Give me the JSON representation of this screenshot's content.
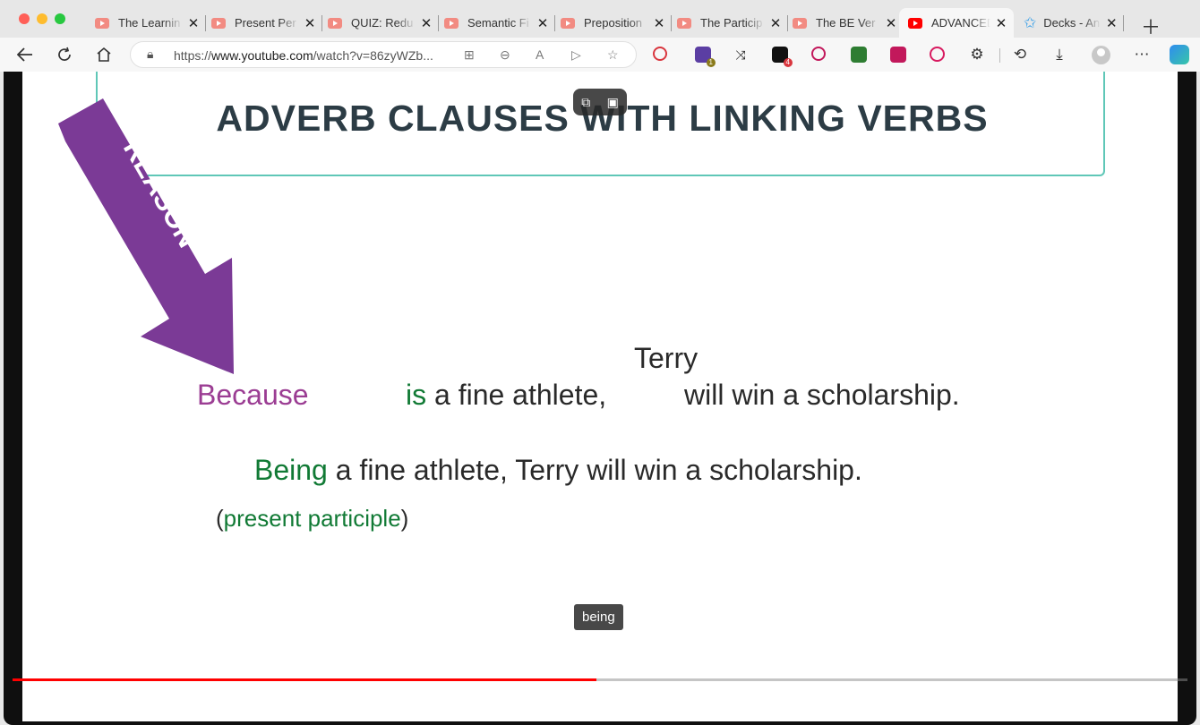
{
  "tabs": [
    {
      "title": "The Learnin",
      "active": false
    },
    {
      "title": "Present Per",
      "active": false
    },
    {
      "title": "QUIZ: Redu",
      "active": false
    },
    {
      "title": "Semantic Fi",
      "active": false
    },
    {
      "title": "Preposition",
      "active": false
    },
    {
      "title": "The Particip",
      "active": false
    },
    {
      "title": "The BE Ver",
      "active": false
    },
    {
      "title": "ADVANCED",
      "active": true
    },
    {
      "title": "Decks - An",
      "active": false
    }
  ],
  "address": {
    "prefix": "https://",
    "domain": "www.youtube.com",
    "path": "/watch?v=86zyWZb..."
  },
  "extensions": [
    {
      "name": "magnifier-extension-icon",
      "color": "#d9363e"
    },
    {
      "name": "pen-extension-icon",
      "color": "#5b3ea3",
      "badge": "1",
      "badge_color": "#8a7a1a"
    },
    {
      "name": "shuffle-extension-icon",
      "color": "#222222"
    },
    {
      "name": "camera-extension-icon",
      "color": "#111111",
      "badge": "4",
      "badge_color": "#d9363e"
    },
    {
      "name": "screen-record-extension-icon",
      "color": "#c2185b"
    },
    {
      "name": "download-green-extension-icon",
      "color": "#2e7d32"
    },
    {
      "name": "trello-extension-icon",
      "color": "#c2185b"
    },
    {
      "name": "play-extension-icon",
      "color": "#d81b60"
    }
  ],
  "slide": {
    "title": "ADVERB CLAUSES WITH LINKING VERBS",
    "arrow_label": "REASON",
    "line1": {
      "because": "Because",
      "is": "is",
      "rest": " a fine athlete,",
      "end": "will win a scholarship."
    },
    "terry": "Terry",
    "line2": {
      "being": "Being",
      "rest": " a fine athlete, Terry will win a scholarship."
    },
    "line3": {
      "open": "(",
      "label": "present participle",
      "close": ")"
    },
    "caption": "being"
  },
  "player": {
    "progress": 0.497
  },
  "colors": {
    "accent_purple": "#7b3a96",
    "accent_green": "#117a35",
    "title_border": "#5fc7b7",
    "progress": "#ff0000"
  }
}
